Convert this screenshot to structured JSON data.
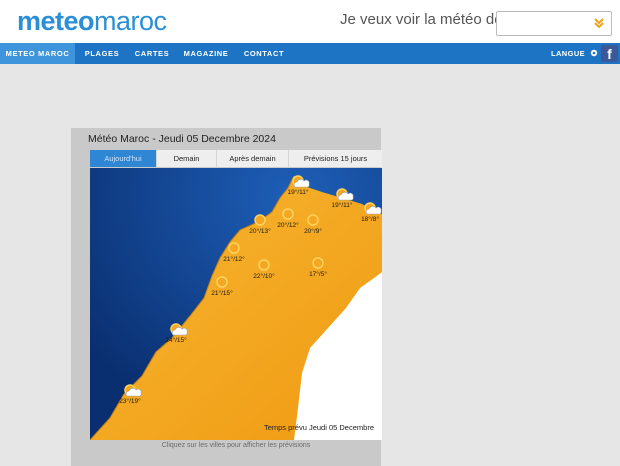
{
  "header": {
    "logo_left": "meteo",
    "logo_right": "maroc",
    "search_label": "Je veux voir la météo de",
    "search_value": ""
  },
  "nav": {
    "items": [
      {
        "label": "METEO MAROC",
        "active": true
      },
      {
        "label": "PLAGES",
        "active": false
      },
      {
        "label": "CARTES",
        "active": false
      },
      {
        "label": "MAGAZINE",
        "active": false
      },
      {
        "label": "CONTACT",
        "active": false
      }
    ],
    "langue": "LANGUE",
    "facebook": "f"
  },
  "widget": {
    "title": "Météo Maroc - Jeudi 05 Decembre 2024",
    "tabs": [
      {
        "label": "Aujourd'hui",
        "active": true
      },
      {
        "label": "Demain",
        "active": false
      },
      {
        "label": "Après demain",
        "active": false
      },
      {
        "label": "Prévisions 15 jours",
        "active": false
      }
    ],
    "map_footer": "Temps prévu Jeudi 05 Decembre",
    "caption": "Cliquez sur les villes pour afficher les prévisions"
  },
  "cities": [
    {
      "temp": "19°/11°",
      "icon": "partly-cloudy-icon"
    },
    {
      "temp": "19°/11°",
      "icon": "cloudy-icon"
    },
    {
      "temp": "18°/8°",
      "icon": "cloudy-icon"
    },
    {
      "temp": "20°/13°",
      "icon": "sun-icon"
    },
    {
      "temp": "20°/12°",
      "icon": "sun-icon"
    },
    {
      "temp": "20°/9°",
      "icon": "sun-icon"
    },
    {
      "temp": "21°/12°",
      "icon": "sun-icon"
    },
    {
      "temp": "22°/10°",
      "icon": "sun-icon"
    },
    {
      "temp": "17°/5°",
      "icon": "sun-icon"
    },
    {
      "temp": "21°/15°",
      "icon": "sun-icon"
    },
    {
      "temp": "24°/15°",
      "icon": "partly-cloudy-icon"
    },
    {
      "temp": "23°/19°",
      "icon": "partly-cloudy-icon"
    }
  ],
  "colors": {
    "brand_blue": "#2a8fd6",
    "nav_blue": "#1d74c4",
    "sun_orange": "#f5a623",
    "land": "#f5aa1e",
    "sea": "#0f3f8c"
  }
}
